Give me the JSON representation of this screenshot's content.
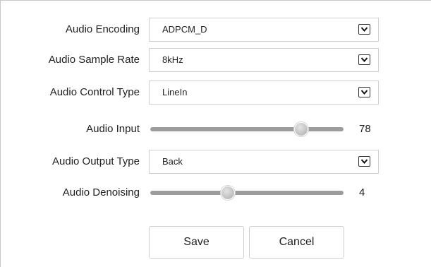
{
  "form": {
    "audio_encoding": {
      "label": "Audio Encoding",
      "value": "ADPCM_D",
      "icon": "dropdown-arrow-icon"
    },
    "audio_sample_rate": {
      "label": "Audio Sample Rate",
      "value": "8kHz",
      "icon": "dropdown-arrow-icon"
    },
    "audio_control_type": {
      "label": "Audio Control Type",
      "value": "LineIn",
      "icon": "dropdown-arrow-icon"
    },
    "audio_input": {
      "label": "Audio Input",
      "value": "78",
      "min": 0,
      "max": 100
    },
    "audio_output_type": {
      "label": "Audio Output Type",
      "value": "Back",
      "icon": "dropdown-arrow-icon"
    },
    "audio_denoising": {
      "label": "Audio Denoising",
      "value": "4",
      "min": 0,
      "max": 10
    }
  },
  "buttons": {
    "save_label": "Save",
    "cancel_label": "Cancel"
  },
  "colors": {
    "border": "#cfcfcf",
    "slider_track": "#9c9c9c",
    "text": "#222222"
  }
}
